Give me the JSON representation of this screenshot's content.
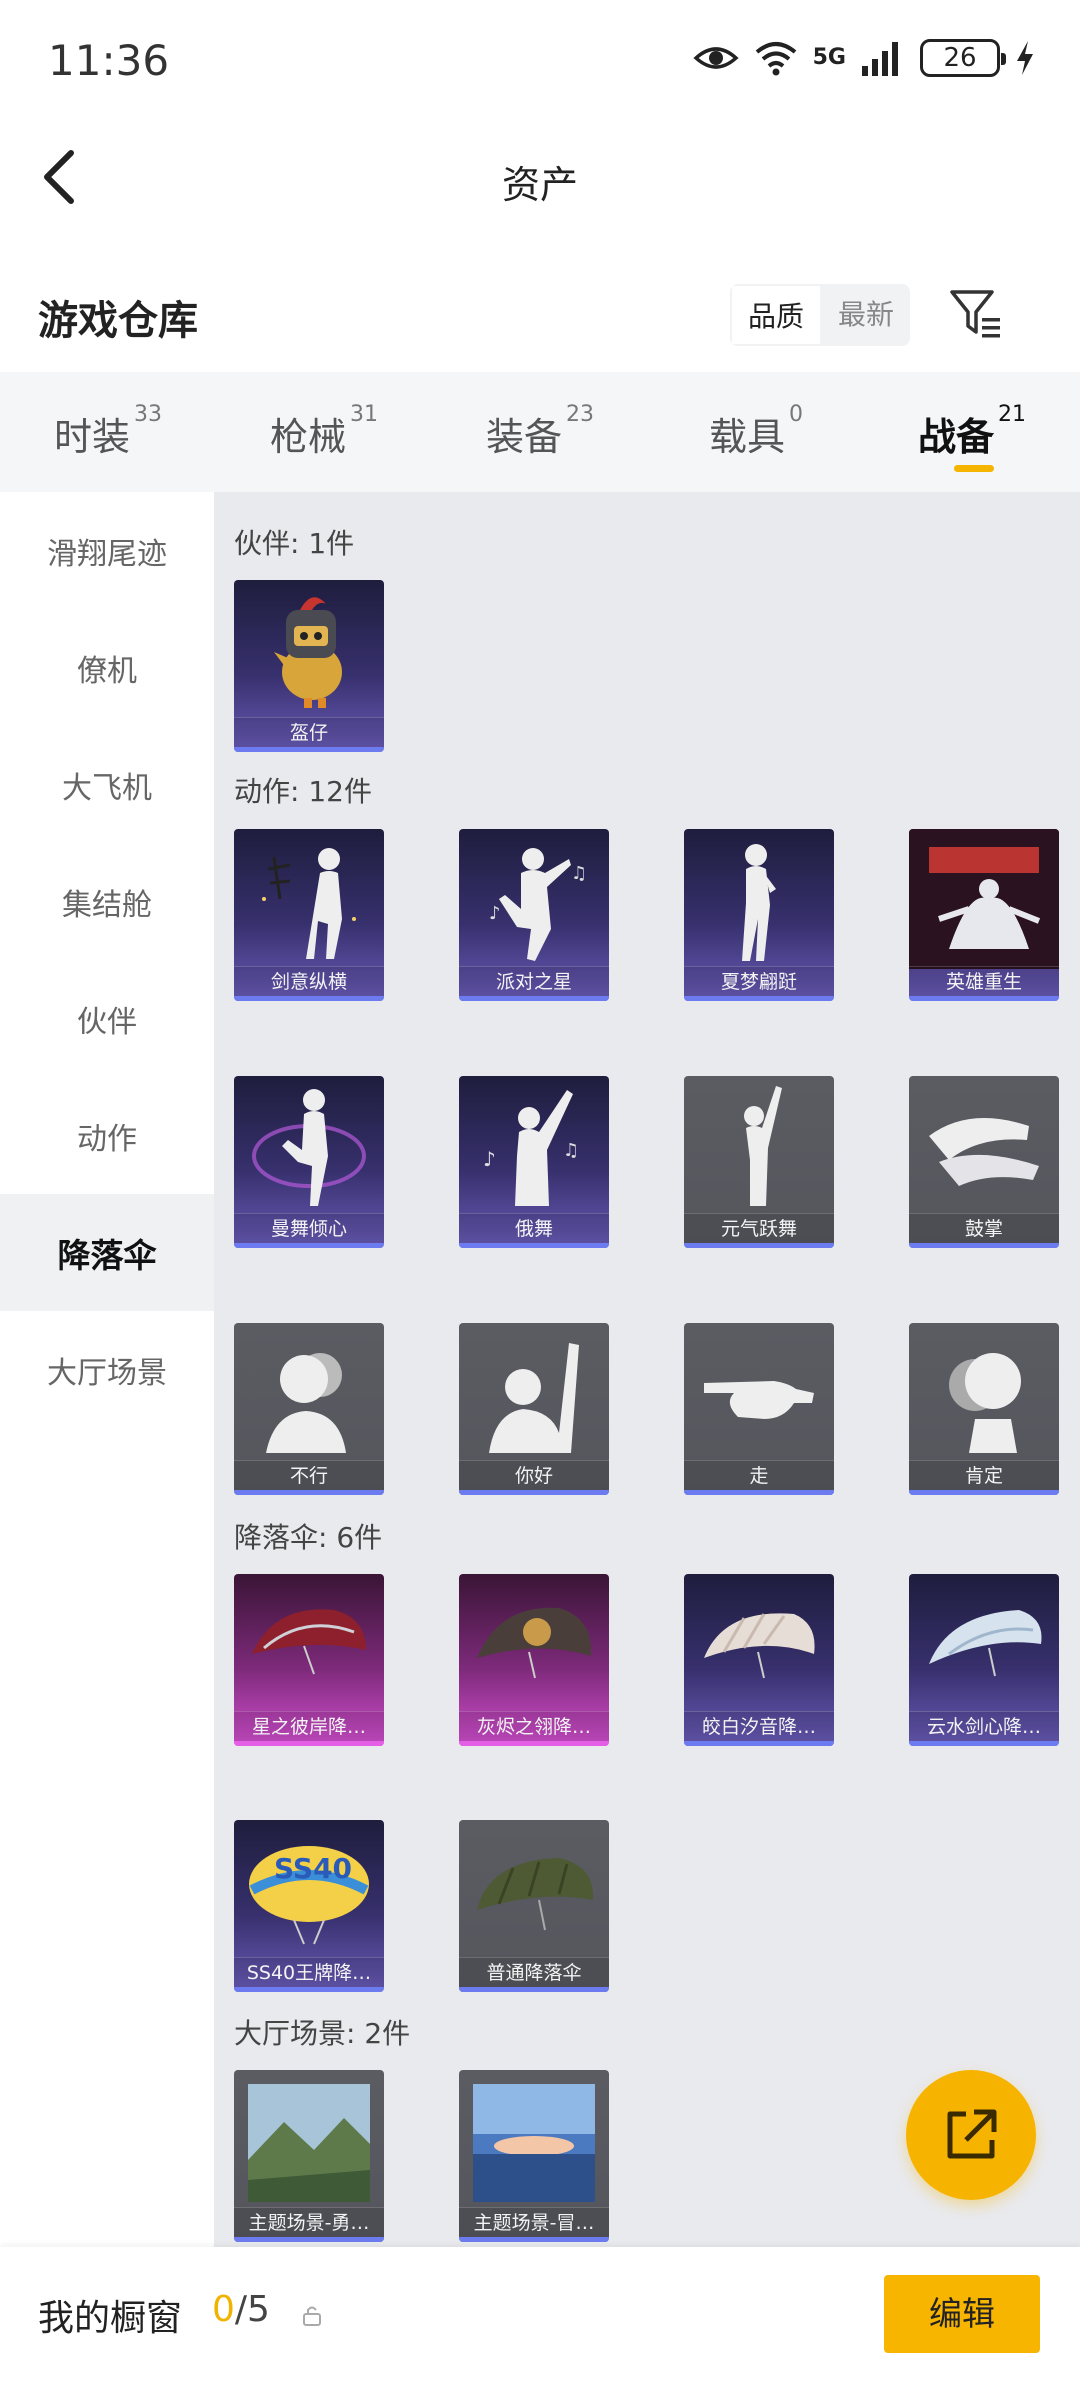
{
  "status": {
    "time": "11:36",
    "network": "5G",
    "battery": "26"
  },
  "header": {
    "title": "资产"
  },
  "warehouse": {
    "title": "游戏仓库",
    "sort_options": [
      "品质",
      "最新"
    ],
    "active_sort": 0
  },
  "tabs": [
    {
      "label": "时装",
      "count": "33"
    },
    {
      "label": "枪械",
      "count": "31"
    },
    {
      "label": "装备",
      "count": "23"
    },
    {
      "label": "载具",
      "count": "0"
    },
    {
      "label": "战备",
      "count": "21"
    }
  ],
  "active_tab": 4,
  "sidebar": {
    "items": [
      "滑翔尾迹",
      "僚机",
      "大飞机",
      "集结舱",
      "伙伴",
      "动作",
      "降落伞",
      "大厅场景"
    ],
    "active": 6
  },
  "sections": {
    "partner": {
      "title": "伙伴: 1件",
      "items": [
        "盔仔"
      ]
    },
    "emote": {
      "title": "动作: 12件",
      "items": [
        "剑意纵横",
        "派对之星",
        "夏梦翩跹",
        "英雄重生",
        "曼舞倾心",
        "俄舞",
        "元气跃舞",
        "鼓掌",
        "不行",
        "你好",
        "走",
        "肯定"
      ]
    },
    "parachute": {
      "title": "降落伞: 6件",
      "items": [
        "星之彼岸降…",
        "灰烬之翎降…",
        "皎白汐音降…",
        "云水剑心降…",
        "SS40王牌降…",
        "普通降落伞"
      ]
    },
    "lobby": {
      "title": "大厅场景: 2件",
      "items": [
        "主题场景-勇…",
        "主题场景-冒…"
      ]
    }
  },
  "bottom": {
    "showcase_label": "我的橱窗",
    "showcase_current": "0",
    "showcase_total": "/5",
    "edit_label": "编辑"
  },
  "colors": {
    "accent": "#f6b400",
    "rarity_purple": "#6c7cf0",
    "rarity_pink": "#e45ee6"
  }
}
